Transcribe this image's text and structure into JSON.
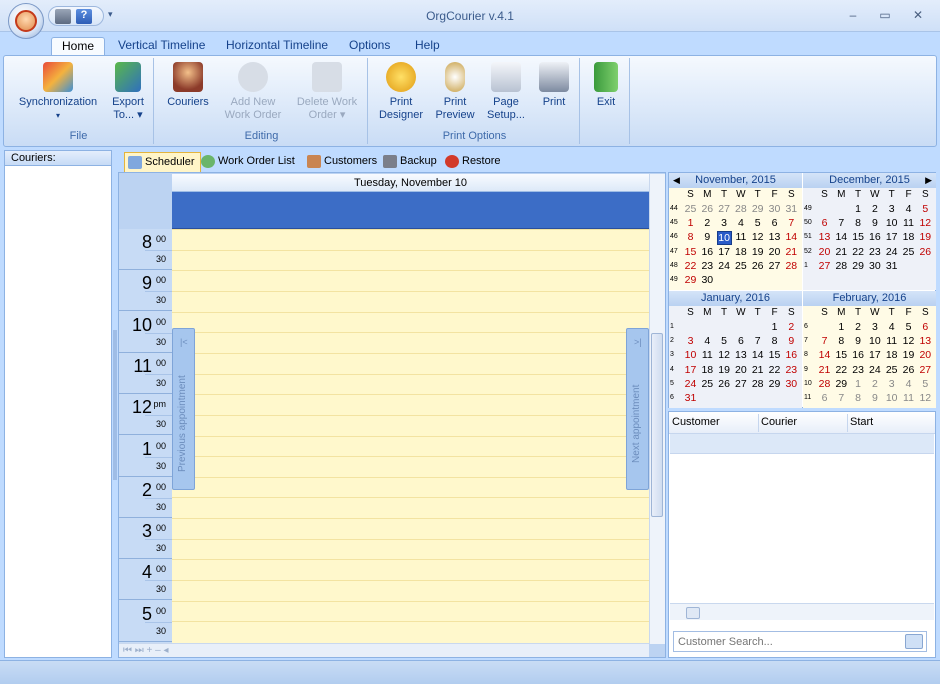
{
  "window": {
    "title": "OrgCourier v.4.1"
  },
  "ribbon_tabs": [
    "Home",
    "Vertical Timeline",
    "Horizontal Timeline",
    "Options",
    "Help"
  ],
  "groups": {
    "file": {
      "label": "File",
      "sync": "Synchronization",
      "sync_arrow": "▾",
      "export1": "Export",
      "export2": "To... ▾"
    },
    "editing": {
      "label": "Editing",
      "couriers": "Couriers",
      "add1": "Add New",
      "add2": "Work Order",
      "del1": "Delete Work",
      "del2": "Order ▾"
    },
    "print": {
      "label": "Print Options",
      "designer1": "Print",
      "designer2": "Designer",
      "preview1": "Print",
      "preview2": "Preview",
      "setup1": "Page",
      "setup2": "Setup...",
      "print": "Print"
    },
    "exit": {
      "label": "Exit"
    }
  },
  "couriers_panel": {
    "header": "Couriers:"
  },
  "view_tabs": [
    "Scheduler",
    "Work Order List",
    "Customers",
    "Backup",
    "Restore"
  ],
  "scheduler": {
    "day_header": "Tuesday, November 10",
    "prev": "Previous appointment",
    "next": "Next appointment",
    "hours": [
      {
        "h": "8",
        "m": "00"
      },
      {
        "h": "9",
        "m": "00"
      },
      {
        "h": "10",
        "m": "00"
      },
      {
        "h": "11",
        "m": "00"
      },
      {
        "h": "12",
        "m": "pm"
      },
      {
        "h": "1",
        "m": "00"
      },
      {
        "h": "2",
        "m": "00"
      },
      {
        "h": "3",
        "m": "00"
      },
      {
        "h": "4",
        "m": "00"
      },
      {
        "h": "5",
        "m": "00"
      }
    ],
    "half": "30"
  },
  "calendar": {
    "weekdays": [
      "S",
      "M",
      "T",
      "W",
      "T",
      "F",
      "S"
    ],
    "months": [
      {
        "title": "November, 2015",
        "weeks": [
          "44",
          "45",
          "46",
          "47",
          "48",
          "49"
        ],
        "rows": [
          [
            "25",
            "26",
            "27",
            "28",
            "29",
            "30",
            "31"
          ],
          [
            "1",
            "2",
            "3",
            "4",
            "5",
            "6",
            "7"
          ],
          [
            "8",
            "9",
            "10",
            "11",
            "12",
            "13",
            "14"
          ],
          [
            "15",
            "16",
            "17",
            "18",
            "19",
            "20",
            "21"
          ],
          [
            "22",
            "23",
            "24",
            "25",
            "26",
            "27",
            "28"
          ],
          [
            "29",
            "30",
            "",
            "",
            "",
            "",
            ""
          ]
        ]
      },
      {
        "title": "December, 2015",
        "weeks": [
          "49",
          "50",
          "51",
          "52",
          "1",
          ""
        ],
        "rows": [
          [
            "",
            "",
            "1",
            "2",
            "3",
            "4",
            "5"
          ],
          [
            "6",
            "7",
            "8",
            "9",
            "10",
            "11",
            "12"
          ],
          [
            "13",
            "14",
            "15",
            "16",
            "17",
            "18",
            "19"
          ],
          [
            "20",
            "21",
            "22",
            "23",
            "24",
            "25",
            "26"
          ],
          [
            "27",
            "28",
            "29",
            "30",
            "31",
            "",
            ""
          ],
          [
            "",
            "",
            "",
            "",
            "",
            "",
            ""
          ]
        ]
      },
      {
        "title": "January, 2016",
        "weeks": [
          "1",
          "2",
          "3",
          "4",
          "5",
          "6"
        ],
        "rows": [
          [
            "",
            "",
            "",
            "",
            "",
            "1",
            "2"
          ],
          [
            "3",
            "4",
            "5",
            "6",
            "7",
            "8",
            "9"
          ],
          [
            "10",
            "11",
            "12",
            "13",
            "14",
            "15",
            "16"
          ],
          [
            "17",
            "18",
            "19",
            "20",
            "21",
            "22",
            "23"
          ],
          [
            "24",
            "25",
            "26",
            "27",
            "28",
            "29",
            "30"
          ],
          [
            "31",
            "",
            "",
            "",
            "",
            "",
            ""
          ]
        ]
      },
      {
        "title": "February, 2016",
        "weeks": [
          "6",
          "7",
          "8",
          "9",
          "10",
          "11"
        ],
        "rows": [
          [
            "",
            "1",
            "2",
            "3",
            "4",
            "5",
            "6"
          ],
          [
            "7",
            "8",
            "9",
            "10",
            "11",
            "12",
            "13"
          ],
          [
            "14",
            "15",
            "16",
            "17",
            "18",
            "19",
            "20"
          ],
          [
            "21",
            "22",
            "23",
            "24",
            "25",
            "26",
            "27"
          ],
          [
            "28",
            "29",
            "1",
            "2",
            "3",
            "4",
            "5"
          ],
          [
            "6",
            "7",
            "8",
            "9",
            "10",
            "11",
            "12"
          ]
        ]
      }
    ]
  },
  "results": {
    "columns": [
      "Customer",
      "Courier",
      "Start"
    ],
    "search_placeholder": "Customer Search..."
  }
}
